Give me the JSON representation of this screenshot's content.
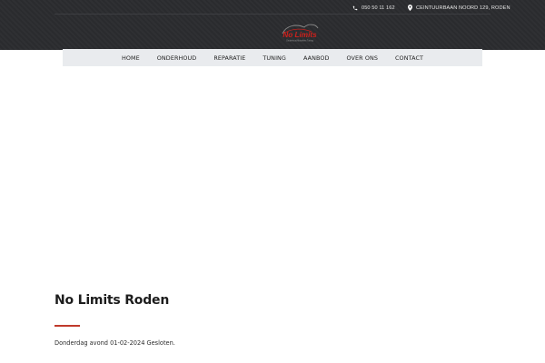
{
  "header": {
    "phone": "050 50 11 162",
    "address": "CEINTUURBAAN NOORD 129, RODEN",
    "icons": {
      "phone": "phone-icon",
      "address": "map-pin-icon"
    },
    "logo": {
      "text": "No Limits",
      "tagline": "Onderhoud Motorfiets Tuning",
      "colors": {
        "text": "#d0211c",
        "tagline": "#9a9a9a"
      }
    }
  },
  "nav": {
    "items": [
      "HOME",
      "ONDERHOUD",
      "REPARATIE",
      "TUNING",
      "AANBOD",
      "OVER ONS",
      "CONTACT"
    ]
  },
  "content": {
    "title": "No Limits Roden",
    "text": "Donderdag avond 01-02-2024 Gesloten."
  },
  "colors": {
    "topbar": "#2a2b2e",
    "navbar": "#e9ebee",
    "accent": "#c0392b"
  }
}
